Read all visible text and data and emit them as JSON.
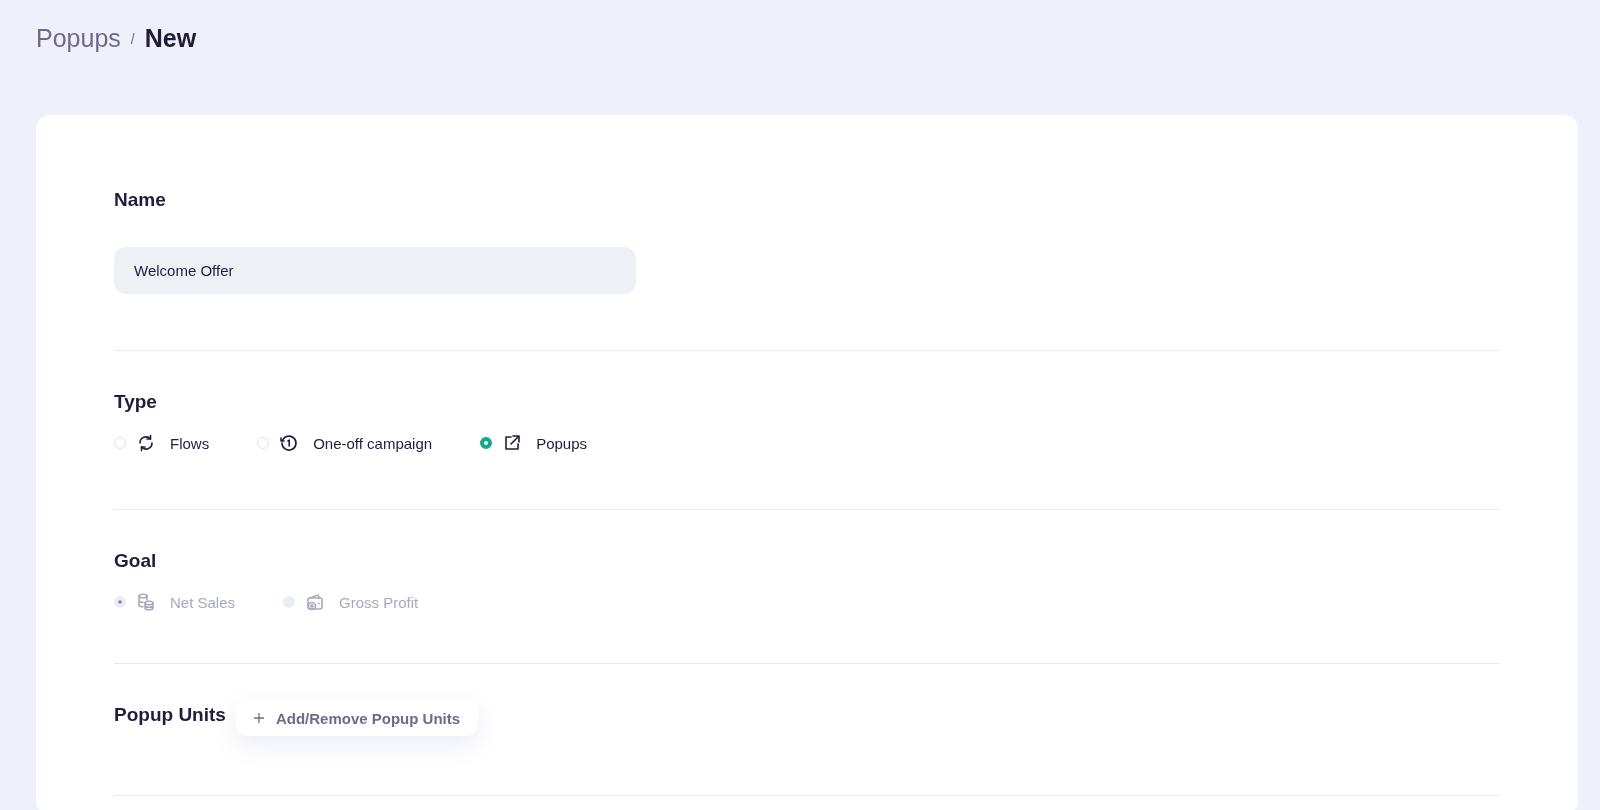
{
  "breadcrumb": {
    "parent": "Popups",
    "separator": "/",
    "current": "New"
  },
  "sections": [
    {
      "kind": "text",
      "title": "Name",
      "value": "Welcome Offer"
    },
    {
      "kind": "radios",
      "title": "Type",
      "disabled": false,
      "options": [
        {
          "label": "Flows",
          "kind": "refresh",
          "selected": false
        },
        {
          "label": "One-off campaign",
          "kind": "clock",
          "selected": false
        },
        {
          "label": "Popups",
          "kind": "external",
          "selected": true
        }
      ]
    },
    {
      "kind": "radios",
      "title": "Goal",
      "disabled": true,
      "options": [
        {
          "label": "Net Sales",
          "kind": "coins",
          "selected": true
        },
        {
          "label": "Gross Profit",
          "kind": "wallet",
          "selected": false
        }
      ]
    },
    {
      "kind": "action",
      "title": "Popup Units",
      "button": "Add/Remove Popup Units"
    }
  ]
}
